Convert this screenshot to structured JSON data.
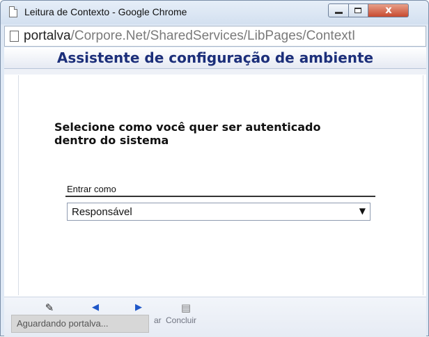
{
  "window": {
    "title": "Leitura de Contexto - Google Chrome",
    "close_glyph": "x"
  },
  "address": {
    "host": "portalva",
    "path": "/Corpore.Net/SharedServices/LibPages/ContextI"
  },
  "page": {
    "header_title": "Assistente de configuração de ambiente",
    "instruction": "Selecione como você quer ser autenticado dentro do sistema",
    "field_label": "Entrar como",
    "select_value": "Responsável",
    "select_arrow": "▼"
  },
  "toolbar": {
    "cancel_icon": "cancel-icon",
    "back_icon": "back-arrow-icon",
    "next_icon": "next-arrow-icon",
    "finish_icon": "document-icon",
    "hidden_label_fragment": "ar",
    "finish_label": "Concluir"
  },
  "status": {
    "text": "Aguardando portalva..."
  },
  "colors": {
    "header_text": "#1c2f7a",
    "arrow_blue": "#1f57c8"
  }
}
